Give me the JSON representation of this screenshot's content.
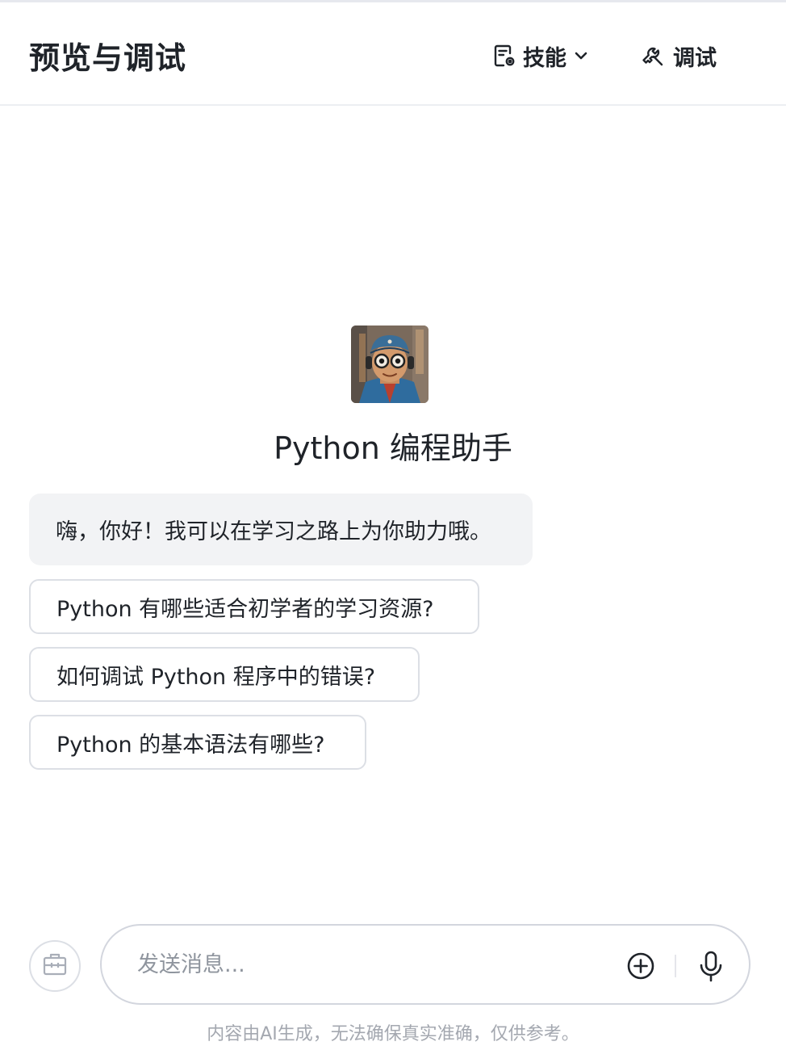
{
  "header": {
    "title": "预览与调试",
    "skills_label": "技能",
    "debug_label": "调试"
  },
  "bot": {
    "name": "Python 编程助手",
    "greeting": "嗨，你好！我可以在学习之路上为你助力哦。"
  },
  "suggestions": [
    "Python 有哪些适合初学者的学习资源?",
    "如何调试 Python 程序中的错误?",
    "Python 的基本语法有哪些?"
  ],
  "composer": {
    "placeholder": "发送消息..."
  },
  "footer": {
    "disclaimer": "内容由AI生成，无法确保真实准确，仅供参考。"
  },
  "icons": {
    "skills": "document-settings-icon",
    "chevron": "chevron-down-icon",
    "debug": "wrench-icon",
    "left_round": "briefcase-icon",
    "add": "plus-circle-icon",
    "mic": "microphone-icon"
  },
  "colors": {
    "text": "#1f2329",
    "greeting_bg": "#f2f3f5",
    "border": "#dcdfe5",
    "muted": "#a4a8b0"
  }
}
